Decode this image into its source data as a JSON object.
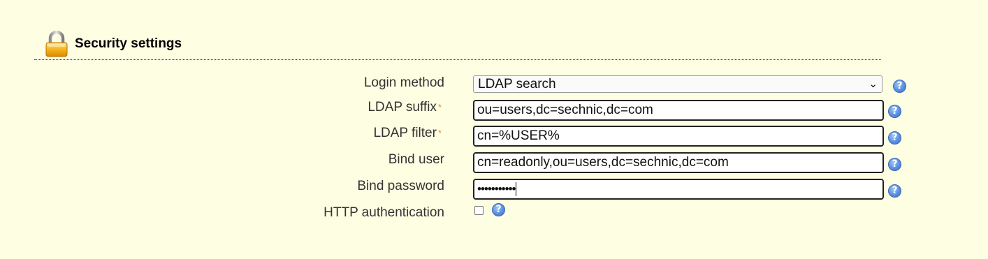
{
  "section": {
    "title": "Security settings",
    "icon": "lock-icon"
  },
  "form": {
    "login_method": {
      "label": "Login method",
      "selected": "LDAP search",
      "help": "?"
    },
    "ldap_suffix": {
      "label": "LDAP suffix",
      "required_mark": "*",
      "value": "ou=users,dc=sechnic,dc=com",
      "help": "?"
    },
    "ldap_filter": {
      "label": "LDAP filter",
      "required_mark": "*",
      "value": "cn=%USER%",
      "help": "?"
    },
    "bind_user": {
      "label": "Bind user",
      "value": "cn=readonly,ou=users,dc=sechnic,dc=com",
      "help": "?"
    },
    "bind_password": {
      "label": "Bind password",
      "value_masked": "•••••••••••",
      "help": "?"
    },
    "http_auth": {
      "label": "HTTP authentication",
      "checked": false,
      "help": "?"
    }
  },
  "colors": {
    "background": "#fefee2",
    "required": "#f0883c",
    "help_icon": "#5a8fe0"
  }
}
